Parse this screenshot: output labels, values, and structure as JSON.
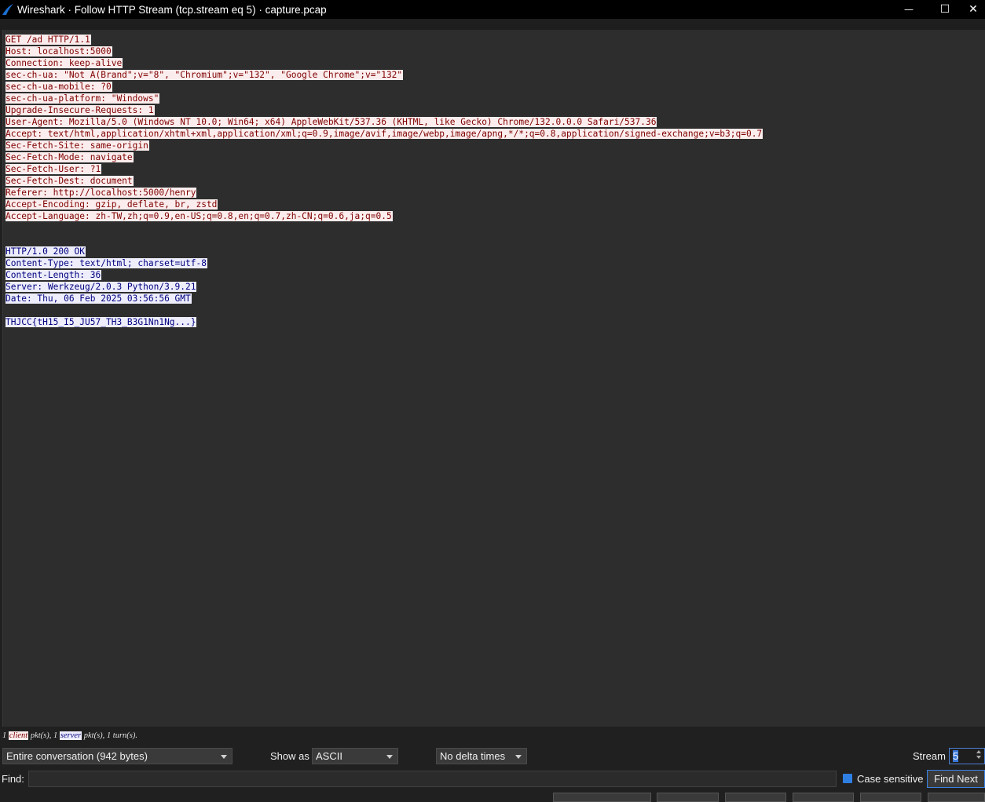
{
  "window": {
    "title": "Wireshark · Follow HTTP Stream (tcp.stream eq 5) · capture.pcap",
    "minimize_glyph": "—",
    "maximize_glyph": "☐",
    "close_glyph": "✕"
  },
  "stream": {
    "client_lines": [
      "GET /ad HTTP/1.1",
      "Host: localhost:5000",
      "Connection: keep-alive",
      "sec-ch-ua: \"Not A(Brand\";v=\"8\", \"Chromium\";v=\"132\", \"Google Chrome\";v=\"132\"",
      "sec-ch-ua-mobile: ?0",
      "sec-ch-ua-platform: \"Windows\"",
      "Upgrade-Insecure-Requests: 1",
      "User-Agent: Mozilla/5.0 (Windows NT 10.0; Win64; x64) AppleWebKit/537.36 (KHTML, like Gecko) Chrome/132.0.0.0 Safari/537.36",
      "Accept: text/html,application/xhtml+xml,application/xml;q=0.9,image/avif,image/webp,image/apng,*/*;q=0.8,application/signed-exchange;v=b3;q=0.7",
      "Sec-Fetch-Site: same-origin",
      "Sec-Fetch-Mode: navigate",
      "Sec-Fetch-User: ?1",
      "Sec-Fetch-Dest: document",
      "Referer: http://localhost:5000/henry",
      "Accept-Encoding: gzip, deflate, br, zstd",
      "Accept-Language: zh-TW,zh;q=0.9,en-US;q=0.8,en;q=0.7,zh-CN;q=0.6,ja;q=0.5"
    ],
    "server_header_lines": [
      "HTTP/1.0 200 OK",
      "Content-Type: text/html; charset=utf-8",
      "Content-Length: 36",
      "Server: Werkzeug/2.0.3 Python/3.9.21",
      "Date: Thu, 06 Feb 2025 03:56:56 GMT"
    ],
    "server_body_lines": [
      "THJCC{tH15_I5_JU57_TH3_B3G1Nn1Ng...}"
    ]
  },
  "stats": {
    "prefix": "1 ",
    "client_tag": "client",
    "middle": " pkt(s), 1 ",
    "server_tag": "server",
    "suffix": " pkt(s), 1 turn(s)."
  },
  "controls": {
    "conversation_value": "Entire conversation (942 bytes)",
    "show_as_label": "Show as",
    "show_as_value": "ASCII",
    "delta_value": "No delta times",
    "stream_label": "Stream",
    "stream_value": "5",
    "find_label": "Find:",
    "find_value": "",
    "case_sensitive_label": "Case sensitive",
    "find_next_label": "Find Next"
  },
  "colors": {
    "client_bg": "#fbeded",
    "client_fg": "#7f0000",
    "server_bg": "#ededfb",
    "server_fg": "#00007f",
    "accent": "#3b82e6"
  }
}
